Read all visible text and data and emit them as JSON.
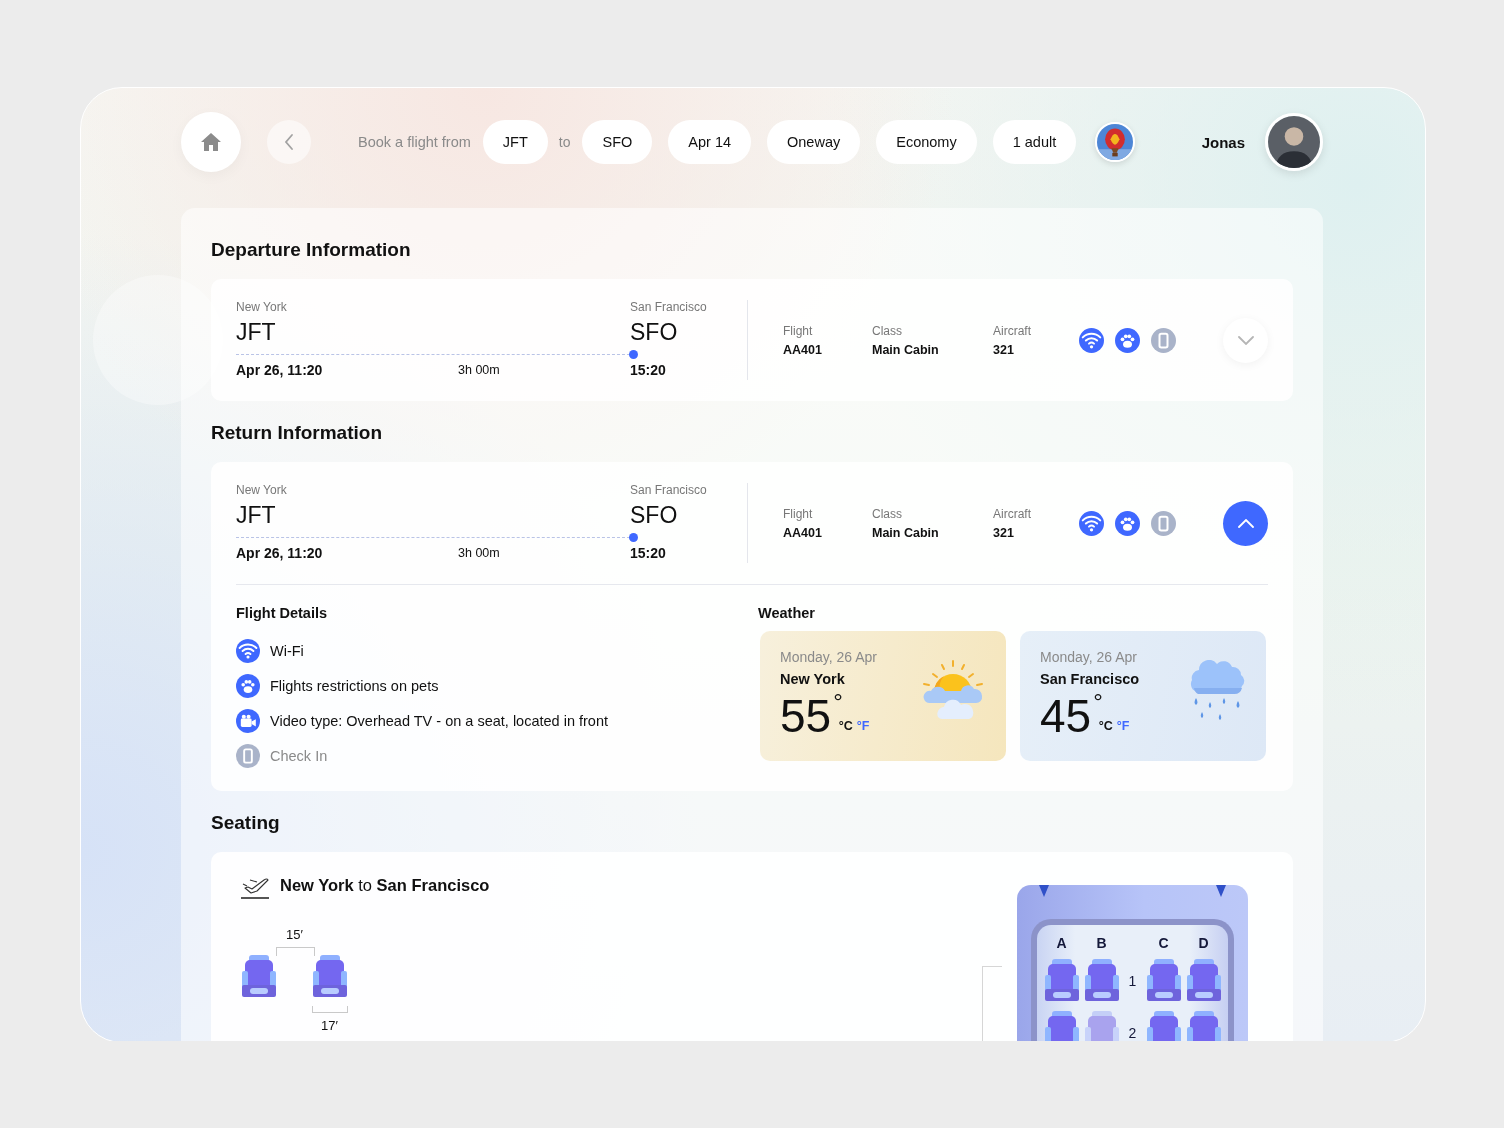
{
  "top_bar": {
    "prompt": "Book a flight from",
    "origin": "JFT",
    "connector": "to",
    "destination": "SFO",
    "options": [
      "Apr 14",
      "Oneway",
      "Economy",
      "1 adult"
    ],
    "user": {
      "name": "Jonas"
    }
  },
  "departure": {
    "title": "Departure Information",
    "expanded": false,
    "origin": {
      "city": "New York",
      "code": "JFT",
      "time": "Apr 26, 11:20"
    },
    "duration": "3h 00m",
    "destination": {
      "city": "San Francisco",
      "code": "SFO",
      "time": "15:20"
    },
    "fields": [
      {
        "label": "Flight",
        "value": "AA401"
      },
      {
        "label": "Class",
        "value": "Main Cabin"
      },
      {
        "label": "Aircraft",
        "value": "321"
      }
    ],
    "amenities": [
      {
        "kind": "wifi",
        "available": true
      },
      {
        "kind": "pets",
        "available": true
      },
      {
        "kind": "checkin",
        "available": false
      }
    ]
  },
  "return": {
    "title": "Return Information",
    "expanded": true,
    "origin": {
      "city": "New York",
      "code": "JFT",
      "time": "Apr 26, 11:20"
    },
    "duration": "3h 00m",
    "destination": {
      "city": "San Francisco",
      "code": "SFO",
      "time": "15:20"
    },
    "fields": [
      {
        "label": "Flight",
        "value": "AA401"
      },
      {
        "label": "Class",
        "value": "Main Cabin"
      },
      {
        "label": "Aircraft",
        "value": "321"
      }
    ],
    "amenities": [
      {
        "kind": "wifi",
        "available": true
      },
      {
        "kind": "pets",
        "available": true
      },
      {
        "kind": "checkin",
        "available": false
      }
    ],
    "details": {
      "title": "Flight Details",
      "items": [
        {
          "kind": "wifi",
          "text": "Wi-Fi",
          "available": true
        },
        {
          "kind": "pets",
          "text": "Flights restrictions on pets",
          "available": true
        },
        {
          "kind": "video",
          "text": "Video type:  Overhead TV - on a seat, located in front",
          "available": true
        },
        {
          "kind": "checkin",
          "text": "Check In",
          "available": false
        }
      ]
    },
    "weather": {
      "title": "Weather",
      "cards": [
        {
          "kind": "sunny",
          "date": "Monday, 26 Apr",
          "city": "New York",
          "temperature": "55",
          "degree": "°",
          "units": [
            {
              "label": "°C",
              "selected": true
            },
            {
              "label": "°F",
              "selected": false
            }
          ]
        },
        {
          "kind": "rain",
          "date": "Monday, 26 Apr",
          "city": "San Francisco",
          "temperature": "45",
          "degree": "°",
          "units": [
            {
              "label": "°C",
              "selected": true
            },
            {
              "label": "°F",
              "selected": false
            }
          ]
        }
      ]
    }
  },
  "seating": {
    "title": "Seating",
    "route": "**New York** to **San Francisco**",
    "seat_pitch": "15′",
    "seat_width": "17′",
    "cabin": {
      "columns": [
        "A",
        "B",
        "C",
        "D"
      ],
      "rows": [
        {
          "label": "1",
          "seats": [
            {
              "available": true
            },
            {
              "available": true
            },
            {
              "available": true
            },
            {
              "available": true
            }
          ]
        },
        {
          "label": "2",
          "seats": [
            {
              "available": true
            },
            {
              "available": false
            },
            {
              "available": true
            },
            {
              "available": true
            }
          ]
        }
      ]
    }
  }
}
